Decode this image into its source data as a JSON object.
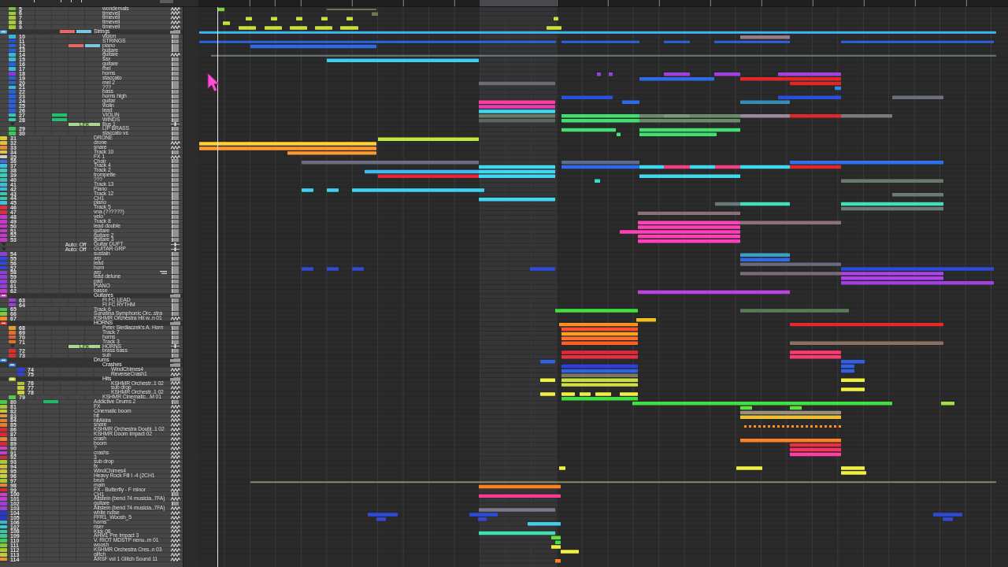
{
  "tracks": [
    {
      "kind": "folder",
      "children": [
        {
          "kind": "audio",
          "number": "5",
          "name": "wondernals",
          "color": "#6cc23a"
        },
        {
          "kind": "audio",
          "number": "6",
          "name": "timeveil",
          "color": "#a8c83a"
        },
        {
          "kind": "audio",
          "number": "7",
          "name": "timeveil",
          "color": "#a8c83a"
        },
        {
          "kind": "audio",
          "number": "8",
          "name": "timeveil",
          "color": "#a8c83a"
        },
        {
          "kind": "audio",
          "number": "9",
          "name": "timeveil",
          "color": "#a8c83a"
        }
      ]
    },
    {
      "kind": "folder",
      "name": "Strings",
      "color": "#4aa8e8",
      "column_3": {
        "color": "#e86868"
      },
      "column_4": {
        "color": "#78c8e0"
      },
      "children": [
        {
          "kind": "instrument",
          "number": "10",
          "name": "violon",
          "color": "#38b8d8"
        },
        {
          "kind": "instrument",
          "number": "11",
          "name": "STRINGS",
          "color": "#2250d0"
        },
        {
          "kind": "instrument",
          "number": "12",
          "name": "piano",
          "color": "#2a5fd8",
          "column_3": {
            "color": "#e86868"
          },
          "column_4": {
            "color": "#78c8e0"
          }
        },
        {
          "kind": "instrument",
          "number": "13",
          "name": "guitare",
          "color": "#2a5fd8"
        },
        {
          "kind": "audio",
          "number": "14",
          "name": "guitare",
          "color": "#38b8d8"
        },
        {
          "kind": "instrument",
          "number": "15",
          "name": "sax",
          "color": "#38b8d8"
        },
        {
          "kind": "instrument",
          "number": "16",
          "name": "guitare",
          "color": "#2a5fd8"
        },
        {
          "kind": "instrument",
          "number": "17",
          "name": "mel",
          "color": "#38b8d8"
        },
        {
          "kind": "instrument",
          "number": "18",
          "name": "horns",
          "color": "#8a3ad8"
        },
        {
          "kind": "instrument",
          "number": "19",
          "name": "staccato",
          "color": "#2a5fd8"
        },
        {
          "kind": "instrument",
          "number": "20",
          "name": "mel 2",
          "color": "#2a5fd8"
        },
        {
          "kind": "instrument",
          "number": "21",
          "name": "???",
          "color": "#38b8d8"
        },
        {
          "kind": "instrument",
          "number": "22",
          "name": "bass",
          "color": "#2a5fd8"
        },
        {
          "kind": "instrument",
          "number": "23",
          "name": "horns high",
          "color": "#2a5fd8"
        },
        {
          "kind": "instrument",
          "number": "24",
          "name": "guitar",
          "color": "#2a5fd8"
        },
        {
          "kind": "instrument",
          "number": "25",
          "name": "violin",
          "color": "#2a5fd8"
        },
        {
          "kind": "instrument",
          "number": "26",
          "name": "lead",
          "color": "#2a5fd8"
        },
        {
          "kind": "instrument",
          "number": "27",
          "name": "VIOLIN",
          "color": "#36c8b0",
          "column_2": {
            "color": "#20c070"
          }
        },
        {
          "kind": "instrument",
          "number": "28",
          "name": "WINDS",
          "color": "#36c8b0",
          "column_2": {
            "color": "#20c070"
          }
        },
        {
          "kind": "aux",
          "name": "Bus 1",
          "columns_3_4": {
            "label": "Link",
            "color": "#a8d890"
          }
        },
        {
          "kind": "instrument",
          "number": "29",
          "name": "LIP BRASS",
          "color": "#3cc860"
        },
        {
          "kind": "instrument",
          "number": "30",
          "name": "staccato vs",
          "color": "#3cc860"
        }
      ]
    },
    {
      "kind": "instrument",
      "number": "31",
      "name": "DRONE",
      "color": "#d8c83a"
    },
    {
      "kind": "audio",
      "number": "32",
      "name": "drone",
      "color": "#e0c040"
    },
    {
      "kind": "audio",
      "number": "33",
      "name": "snare",
      "color": "#e08a3a"
    },
    {
      "kind": "instrument",
      "number": "34",
      "name": "Track 10",
      "color": "#d8c83a"
    },
    {
      "kind": "audio",
      "number": "35",
      "name": "FX 1",
      "color": "#d0d0d0"
    },
    {
      "kind": "instrument",
      "number": "36",
      "name": "Choir",
      "color": "#3a70e0"
    },
    {
      "kind": "instrument",
      "number": "37",
      "name": "Track 4",
      "color": "#40c0e0"
    },
    {
      "kind": "instrument",
      "number": "38",
      "name": "Track 2",
      "color": "#40c8b8"
    },
    {
      "kind": "instrument",
      "number": "39",
      "name": "trompette",
      "color": "#40c8b8"
    },
    {
      "kind": "instrument",
      "number": "40",
      "name": "???",
      "color": "#3ac0a8"
    },
    {
      "kind": "instrument",
      "number": "41",
      "name": "Track 13",
      "color": "#40b8d8"
    },
    {
      "kind": "instrument",
      "number": "42",
      "name": "Piano",
      "color": "#40b8d8"
    },
    {
      "kind": "instrument",
      "number": "43",
      "name": "Track 12",
      "color": "#3ac8b0"
    },
    {
      "kind": "instrument",
      "number": "44",
      "name": "CH1",
      "color": "#3ac8b0"
    },
    {
      "kind": "instrument",
      "number": "45",
      "name": "piano",
      "color": "#40c0d8"
    },
    {
      "kind": "instrument",
      "number": "46",
      "name": "Track 5",
      "color": "#d83040"
    },
    {
      "kind": "instrument",
      "number": "47",
      "name": "vna (??????)",
      "color": "#d83040"
    },
    {
      "kind": "instrument",
      "number": "48",
      "name": "velo",
      "color": "#c838c8"
    },
    {
      "kind": "instrument",
      "number": "49",
      "name": "Track 8",
      "color": "#c838c8"
    },
    {
      "kind": "instrument",
      "number": "50",
      "name": "lead double",
      "color": "#c838c8"
    },
    {
      "kind": "instrument",
      "number": "51",
      "name": "guitare",
      "color": "#c838c8"
    },
    {
      "kind": "instrument",
      "number": "52",
      "name": "guitare 2",
      "color": "#c838c8"
    },
    {
      "kind": "instrument",
      "number": "53",
      "name": "guitare 3",
      "color": "#c838c8"
    },
    {
      "kind": "aux",
      "name": "Guitar DUFT",
      "columns_3_4": {
        "label": "Auto: Off"
      }
    },
    {
      "kind": "aux",
      "name": "GUITAR GRP",
      "columns_3_4": {
        "label": "Auto: Off"
      }
    },
    {
      "kind": "instrument",
      "number": "54",
      "name": "sustain",
      "color": "#9040d8"
    },
    {
      "kind": "instrument",
      "number": "55",
      "name": "arp",
      "color": "#3048d8"
    },
    {
      "kind": "instrument",
      "number": "56",
      "name": "lead",
      "color": "#3048d8"
    },
    {
      "kind": "instrument",
      "number": "57",
      "name": "horn",
      "color": "#3048d8"
    },
    {
      "kind": "instrument",
      "number": "58",
      "name": "arp",
      "color": "#9040d8",
      "extra_icon": true
    },
    {
      "kind": "instrument",
      "number": "59",
      "name": "lead detune",
      "color": "#9040d8"
    },
    {
      "kind": "instrument",
      "number": "60",
      "name": "pad",
      "color": "#9040d8"
    },
    {
      "kind": "instrument",
      "number": "61",
      "name": "PIANO",
      "color": "#9040d8"
    },
    {
      "kind": "instrument",
      "number": "62",
      "name": "basse",
      "color": "#c040c8"
    },
    {
      "kind": "folder",
      "name": "Guitares",
      "color": "#d040c8",
      "children": [
        {
          "kind": "instrument",
          "number": "63",
          "name": "FI FC LEAD",
          "color": "#9a40d8"
        },
        {
          "kind": "instrument",
          "number": "64",
          "name": "FI FC RYTHM",
          "color": "#9a40d8"
        }
      ]
    },
    {
      "kind": "instrument",
      "number": "65",
      "name": "Track 6",
      "color": "#3cc850"
    },
    {
      "kind": "instrument",
      "number": "66",
      "name": "Sonatina Symphonic Orc..stra",
      "color": "#88c838"
    },
    {
      "kind": "audio",
      "number": "67",
      "name": "KSHMR Orchestra Hit w..n 01",
      "color": "#e89030"
    },
    {
      "kind": "folder",
      "name": "HORNS",
      "color": "#e03030",
      "children": [
        {
          "kind": "instrument",
          "number": "68",
          "name": "Peter Siedlaczek's A. Horn",
          "color": "#e0a030"
        },
        {
          "kind": "instrument",
          "number": "69",
          "name": "Track 7",
          "color": "#e07030"
        },
        {
          "kind": "instrument",
          "number": "70",
          "name": "horns",
          "color": "#e06030"
        },
        {
          "kind": "instrument",
          "number": "71",
          "name": "Track 3",
          "color": "#e07030"
        },
        {
          "kind": "aux",
          "name": "HORNS",
          "columns_3_4": {
            "label": "Link",
            "color": "#a8d890"
          }
        },
        {
          "kind": "instrument",
          "number": "72",
          "name": "brass bass",
          "color": "#d83030"
        },
        {
          "kind": "instrument",
          "number": "73",
          "name": "sub",
          "color": "#d83030"
        }
      ]
    },
    {
      "kind": "folder",
      "name": "Drums",
      "color": "#3a8ae0",
      "children": [
        {
          "kind": "folder",
          "name": "Crashes",
          "color": "#3a80e0",
          "children": [
            {
              "kind": "audio",
              "number": "74",
              "name": "WindChimes4",
              "color": "#3040d8"
            },
            {
              "kind": "audio",
              "number": "75",
              "name": "ReverseCrash1",
              "color": "#3040d8"
            }
          ]
        },
        {
          "kind": "folder",
          "name": "Hits",
          "color": "#c8d040",
          "children": [
            {
              "kind": "audio",
              "number": "76",
              "name": "KSHMR Orchestr..1 02",
              "color": "#a8c838"
            },
            {
              "kind": "audio",
              "number": "77",
              "name": "sub drop",
              "color": "#c8d040"
            },
            {
              "kind": "audio",
              "number": "78",
              "name": "KSHMR Orchestr..1 02",
              "color": "#c8d040"
            }
          ]
        },
        {
          "kind": "audio",
          "number": "79",
          "name": "KSHMR Cinematic...M 01",
          "color": "#5cc850"
        }
      ]
    },
    {
      "kind": "instrument",
      "number": "80",
      "name": "Addictive Drums 2",
      "color": "#4cc840",
      "column_2": {
        "color": "#20b868"
      }
    },
    {
      "kind": "audio",
      "number": "81",
      "name": "FX",
      "color": "#a8c838"
    },
    {
      "kind": "audio",
      "number": "82",
      "name": "Cinematic boom",
      "color": "#c8c840"
    },
    {
      "kind": "audio",
      "number": "83",
      "name": "hit",
      "color": "#e09838"
    },
    {
      "kind": "audio",
      "number": "84",
      "name": "hitAkira",
      "color": "#e08030"
    },
    {
      "kind": "audio",
      "number": "85",
      "name": "snare",
      "color": "#e08030"
    },
    {
      "kind": "audio",
      "number": "86",
      "name": "KSHMR Orchestra Doubl..1 02",
      "color": "#d82838"
    },
    {
      "kind": "audio",
      "number": "87",
      "name": "KSHMR Doom Impact 02",
      "color": "#d82838"
    },
    {
      "kind": "audio",
      "number": "88",
      "name": "crash",
      "color": "#e08838"
    },
    {
      "kind": "audio",
      "number": "89",
      "name": "boom",
      "color": "#d82838"
    },
    {
      "kind": "audio",
      "number": "90",
      "name": "?",
      "color": "#d040c0"
    },
    {
      "kind": "audio",
      "number": "91",
      "name": "crashs",
      "color": "#c040d0"
    },
    {
      "kind": "audio",
      "number": "92",
      "name": "3",
      "color": "#d82838"
    },
    {
      "kind": "audio",
      "number": "93",
      "name": "sub drop",
      "color": "#a8c838"
    },
    {
      "kind": "audio",
      "number": "94",
      "name": "fx",
      "color": "#d0c040"
    },
    {
      "kind": "audio",
      "number": "95",
      "name": "WindChimes4",
      "color": "#c8c840"
    },
    {
      "kind": "audio",
      "number": "96",
      "name": "Heavy Rock Fill I -4 (2CH1",
      "color": "#c8d040"
    },
    {
      "kind": "audio",
      "number": "97",
      "name": "bruh",
      "color": "#a8c838"
    },
    {
      "kind": "audio",
      "number": "98",
      "name": "main",
      "color": "#e08838"
    },
    {
      "kind": "audio",
      "number": "99",
      "name": "FX - Butterfly - F minor",
      "color": "#d82838"
    },
    {
      "kind": "instrument",
      "number": "100",
      "name": "CH1",
      "color": "#d040c0"
    },
    {
      "kind": "audio",
      "number": "101",
      "name": "Altstein (bend 74 musicia..7FA)",
      "color": "#c040d0"
    },
    {
      "kind": "instrument",
      "number": "102",
      "name": "guitare",
      "color": "#9a40d8"
    },
    {
      "kind": "audio",
      "number": "103",
      "name": "Altstein (bend 74 musicia..7FA)",
      "color": "#9a40d8"
    },
    {
      "kind": "audio",
      "number": "104",
      "name": "white noise",
      "color": "#2838c8"
    },
    {
      "kind": "audio",
      "number": "105",
      "name": "FFR1_Woosh_5",
      "color": "#2838c8"
    },
    {
      "kind": "audio",
      "number": "106",
      "name": "horns",
      "color": "#38b8d8"
    },
    {
      "kind": "audio",
      "number": "107",
      "name": "riser",
      "color": "#38c8d8"
    },
    {
      "kind": "audio",
      "number": "108",
      "name": "Kick 08",
      "color": "#38c8b0"
    },
    {
      "kind": "audio",
      "number": "109",
      "name": "AHM1 Pre Impact 3",
      "color": "#40c890"
    },
    {
      "kind": "audio",
      "number": "110",
      "name": "V. RIOT MDSTP nenu..m 01",
      "color": "#40c860"
    },
    {
      "kind": "audio",
      "number": "111",
      "name": "woosh",
      "color": "#88c838"
    },
    {
      "kind": "audio",
      "number": "112",
      "name": "KSHMR Orchestra Cres..n 03",
      "color": "#a8c838"
    },
    {
      "kind": "audio",
      "number": "113",
      "name": "glitch",
      "color": "#c8c840"
    },
    {
      "kind": "audio",
      "number": "114",
      "name": "ARSF vol 1 Glitch Sound 11",
      "color": "#e09838"
    }
  ]
}
